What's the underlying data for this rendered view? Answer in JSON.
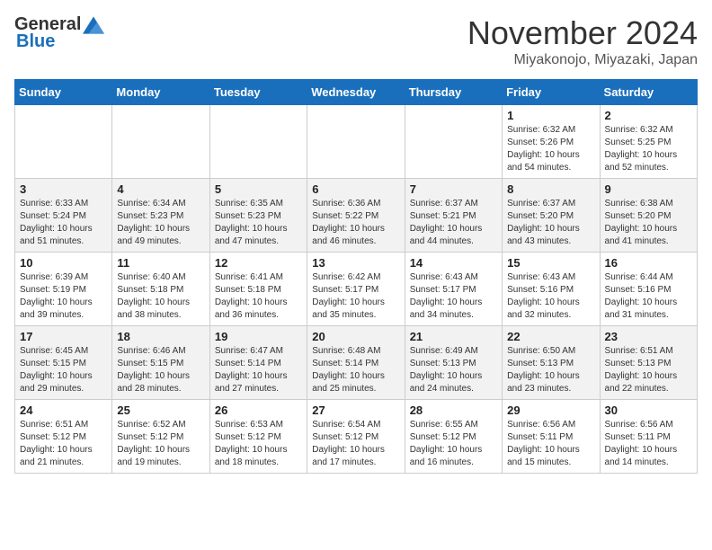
{
  "header": {
    "logo_general": "General",
    "logo_blue": "Blue",
    "month": "November 2024",
    "location": "Miyakonojo, Miyazaki, Japan"
  },
  "days_of_week": [
    "Sunday",
    "Monday",
    "Tuesday",
    "Wednesday",
    "Thursday",
    "Friday",
    "Saturday"
  ],
  "weeks": [
    [
      {
        "day": "",
        "info": ""
      },
      {
        "day": "",
        "info": ""
      },
      {
        "day": "",
        "info": ""
      },
      {
        "day": "",
        "info": ""
      },
      {
        "day": "",
        "info": ""
      },
      {
        "day": "1",
        "info": "Sunrise: 6:32 AM\nSunset: 5:26 PM\nDaylight: 10 hours and 54 minutes."
      },
      {
        "day": "2",
        "info": "Sunrise: 6:32 AM\nSunset: 5:25 PM\nDaylight: 10 hours and 52 minutes."
      }
    ],
    [
      {
        "day": "3",
        "info": "Sunrise: 6:33 AM\nSunset: 5:24 PM\nDaylight: 10 hours and 51 minutes."
      },
      {
        "day": "4",
        "info": "Sunrise: 6:34 AM\nSunset: 5:23 PM\nDaylight: 10 hours and 49 minutes."
      },
      {
        "day": "5",
        "info": "Sunrise: 6:35 AM\nSunset: 5:23 PM\nDaylight: 10 hours and 47 minutes."
      },
      {
        "day": "6",
        "info": "Sunrise: 6:36 AM\nSunset: 5:22 PM\nDaylight: 10 hours and 46 minutes."
      },
      {
        "day": "7",
        "info": "Sunrise: 6:37 AM\nSunset: 5:21 PM\nDaylight: 10 hours and 44 minutes."
      },
      {
        "day": "8",
        "info": "Sunrise: 6:37 AM\nSunset: 5:20 PM\nDaylight: 10 hours and 43 minutes."
      },
      {
        "day": "9",
        "info": "Sunrise: 6:38 AM\nSunset: 5:20 PM\nDaylight: 10 hours and 41 minutes."
      }
    ],
    [
      {
        "day": "10",
        "info": "Sunrise: 6:39 AM\nSunset: 5:19 PM\nDaylight: 10 hours and 39 minutes."
      },
      {
        "day": "11",
        "info": "Sunrise: 6:40 AM\nSunset: 5:18 PM\nDaylight: 10 hours and 38 minutes."
      },
      {
        "day": "12",
        "info": "Sunrise: 6:41 AM\nSunset: 5:18 PM\nDaylight: 10 hours and 36 minutes."
      },
      {
        "day": "13",
        "info": "Sunrise: 6:42 AM\nSunset: 5:17 PM\nDaylight: 10 hours and 35 minutes."
      },
      {
        "day": "14",
        "info": "Sunrise: 6:43 AM\nSunset: 5:17 PM\nDaylight: 10 hours and 34 minutes."
      },
      {
        "day": "15",
        "info": "Sunrise: 6:43 AM\nSunset: 5:16 PM\nDaylight: 10 hours and 32 minutes."
      },
      {
        "day": "16",
        "info": "Sunrise: 6:44 AM\nSunset: 5:16 PM\nDaylight: 10 hours and 31 minutes."
      }
    ],
    [
      {
        "day": "17",
        "info": "Sunrise: 6:45 AM\nSunset: 5:15 PM\nDaylight: 10 hours and 29 minutes."
      },
      {
        "day": "18",
        "info": "Sunrise: 6:46 AM\nSunset: 5:15 PM\nDaylight: 10 hours and 28 minutes."
      },
      {
        "day": "19",
        "info": "Sunrise: 6:47 AM\nSunset: 5:14 PM\nDaylight: 10 hours and 27 minutes."
      },
      {
        "day": "20",
        "info": "Sunrise: 6:48 AM\nSunset: 5:14 PM\nDaylight: 10 hours and 25 minutes."
      },
      {
        "day": "21",
        "info": "Sunrise: 6:49 AM\nSunset: 5:13 PM\nDaylight: 10 hours and 24 minutes."
      },
      {
        "day": "22",
        "info": "Sunrise: 6:50 AM\nSunset: 5:13 PM\nDaylight: 10 hours and 23 minutes."
      },
      {
        "day": "23",
        "info": "Sunrise: 6:51 AM\nSunset: 5:13 PM\nDaylight: 10 hours and 22 minutes."
      }
    ],
    [
      {
        "day": "24",
        "info": "Sunrise: 6:51 AM\nSunset: 5:12 PM\nDaylight: 10 hours and 21 minutes."
      },
      {
        "day": "25",
        "info": "Sunrise: 6:52 AM\nSunset: 5:12 PM\nDaylight: 10 hours and 19 minutes."
      },
      {
        "day": "26",
        "info": "Sunrise: 6:53 AM\nSunset: 5:12 PM\nDaylight: 10 hours and 18 minutes."
      },
      {
        "day": "27",
        "info": "Sunrise: 6:54 AM\nSunset: 5:12 PM\nDaylight: 10 hours and 17 minutes."
      },
      {
        "day": "28",
        "info": "Sunrise: 6:55 AM\nSunset: 5:12 PM\nDaylight: 10 hours and 16 minutes."
      },
      {
        "day": "29",
        "info": "Sunrise: 6:56 AM\nSunset: 5:11 PM\nDaylight: 10 hours and 15 minutes."
      },
      {
        "day": "30",
        "info": "Sunrise: 6:56 AM\nSunset: 5:11 PM\nDaylight: 10 hours and 14 minutes."
      }
    ]
  ]
}
